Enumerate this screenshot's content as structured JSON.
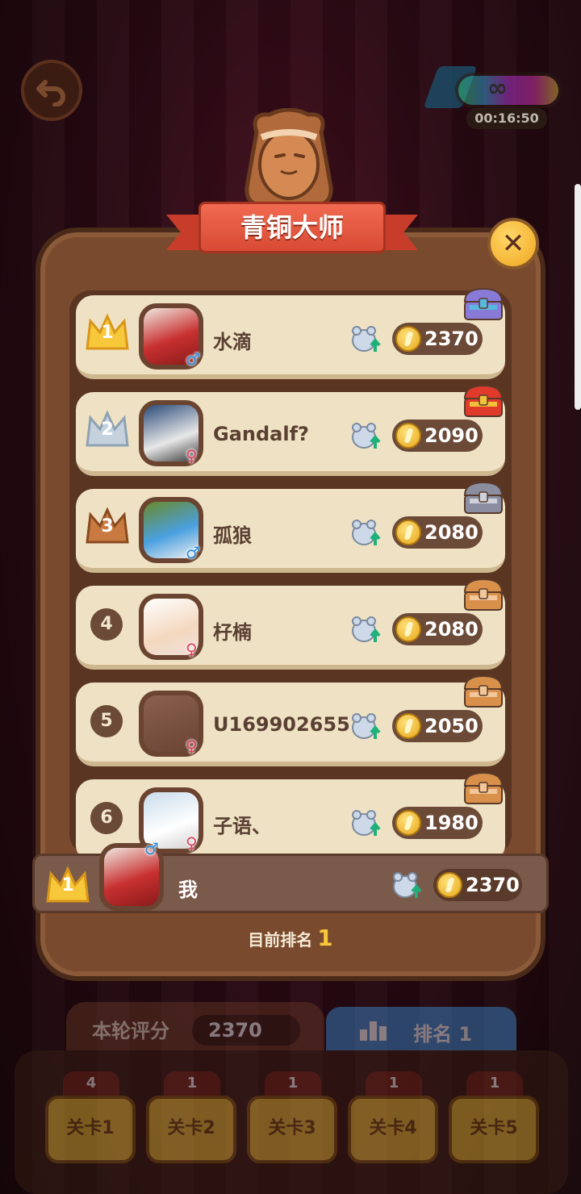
{
  "header": {
    "timer": "00:16:50",
    "infinite_symbol": "∞"
  },
  "dialog": {
    "title": "青铜大师",
    "close_symbol": "✕"
  },
  "leaderboard": [
    {
      "rank": "1",
      "name": "水滴",
      "gender": "male",
      "score": "2370",
      "chest": "rainbow"
    },
    {
      "rank": "2",
      "name": "Gandalf?",
      "gender": "female",
      "score": "2090",
      "chest": "red"
    },
    {
      "rank": "3",
      "name": "孤狼",
      "gender": "male",
      "score": "2080",
      "chest": "silver"
    },
    {
      "rank": "4",
      "name": "杍楠",
      "gender": "female",
      "score": "2080",
      "chest": "wood"
    },
    {
      "rank": "5",
      "name": "U169902655",
      "gender": "female",
      "score": "2050",
      "chest": "wood"
    },
    {
      "rank": "6",
      "name": "子语、",
      "gender": "female",
      "score": "1980",
      "chest": "wood"
    }
  ],
  "my_row": {
    "rank": "1",
    "name": "我",
    "gender": "male",
    "score": "2370"
  },
  "current_rank": {
    "label": "目前排名",
    "value": "1"
  },
  "gender_symbols": {
    "male": "♂",
    "female": "♀"
  },
  "bottom": {
    "score_label": "本轮评分",
    "score_value": "2370",
    "rank_label": "排名 1",
    "levels": [
      {
        "label": "关卡1",
        "count": "4"
      },
      {
        "label": "关卡2",
        "count": "1"
      },
      {
        "label": "关卡3",
        "count": "1"
      },
      {
        "label": "关卡4",
        "count": "1"
      },
      {
        "label": "关卡5",
        "count": "1"
      }
    ]
  },
  "colors": {
    "gold": "#f7c83a",
    "silver": "#c5d2de",
    "bronze": "#c97a40",
    "ribbon": "#e4553f",
    "male": "#2c8ee0",
    "female": "#e0405a"
  }
}
